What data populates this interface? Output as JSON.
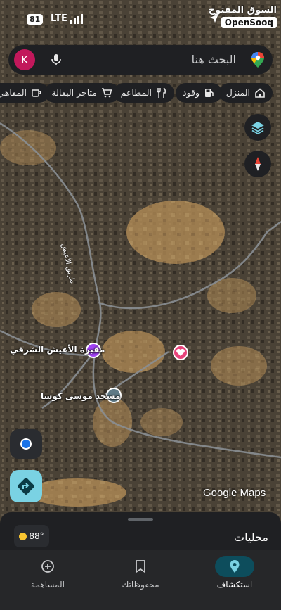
{
  "status_bar": {
    "battery": "81",
    "network": "LTE",
    "brand_arabic": "السوق المفتوح",
    "brand_english": "OpenSooq"
  },
  "search": {
    "avatar_letter": "K",
    "placeholder": "البحث هنا"
  },
  "chips": [
    {
      "label": "المنزل",
      "icon": "home-icon"
    },
    {
      "label": "وقود",
      "icon": "gas-station-icon"
    },
    {
      "label": "المطاعم",
      "icon": "restaurant-icon"
    },
    {
      "label": "متاجر البقالة",
      "icon": "shopping-cart-icon"
    },
    {
      "label": "المقاهي",
      "icon": "coffee-icon"
    }
  ],
  "map": {
    "places": [
      {
        "label": "مقبرة الأعيش الشرقي",
        "icon": "cemetery-icon",
        "color": "#a142f4"
      },
      {
        "label": "مسجد موسى كوسا",
        "icon": "mosque-icon",
        "color": "#5f7a86"
      },
      {
        "label": "",
        "icon": "heart-icon",
        "color": "#e8437a"
      }
    ],
    "road_labels": [
      "طريق الأعيش"
    ],
    "attribution": "Google Maps"
  },
  "bottom_sheet": {
    "temperature": "88°",
    "title": "محليات"
  },
  "nav": [
    {
      "label": "استكشاف",
      "icon": "explore-pin-icon",
      "active": true
    },
    {
      "label": "محفوظاتك",
      "icon": "bookmark-icon",
      "active": false
    },
    {
      "label": "المساهمة",
      "icon": "add-circle-icon",
      "active": false
    }
  ],
  "colors": {
    "accent": "#7ad2e3",
    "surface": "#1f2023",
    "active_nav": "#0d4d5c"
  }
}
